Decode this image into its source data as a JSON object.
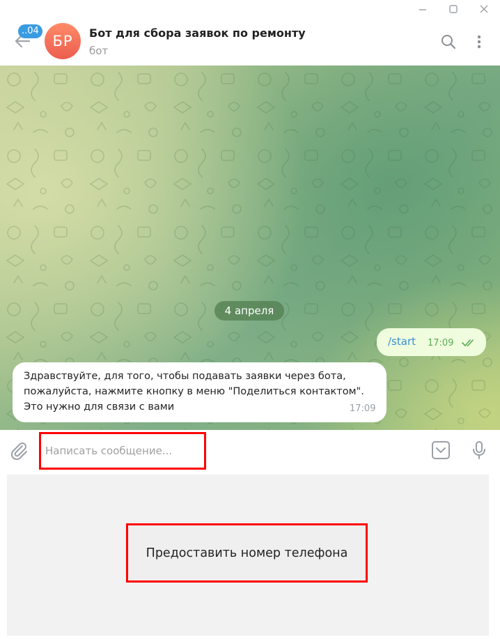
{
  "header": {
    "unread_badge": "..04",
    "avatar_initials": "БР",
    "title": "Бот для сбора заявок по ремонту",
    "subtitle": "бот"
  },
  "chat": {
    "date_separator": "4 апреля",
    "messages": [
      {
        "direction": "outgoing",
        "text": "/start",
        "time": "17:09",
        "status": "read"
      },
      {
        "direction": "incoming",
        "text": "Здравствуйте, для того, чтобы подавать заявки через бота, пожалуйста, нажмите кнопку в меню \"Поделиться контактом\". Это нужно для связи с вами",
        "time": "17:09"
      }
    ]
  },
  "composer": {
    "placeholder": "Написать сообщение..."
  },
  "keyboard": {
    "button_label": "Предоставить номер телефона"
  },
  "icons": [
    "minimize-icon",
    "maximize-icon",
    "close-icon",
    "back-arrow-icon",
    "search-icon",
    "more-vertical-icon",
    "paperclip-icon",
    "bot-keyboard-icon",
    "microphone-icon",
    "double-check-icon"
  ],
  "colors": {
    "accent": "#3a9ce0",
    "avatar": "#ec5d4e",
    "outgoing_bubble": "#effdde",
    "highlight": "#ff0000"
  }
}
